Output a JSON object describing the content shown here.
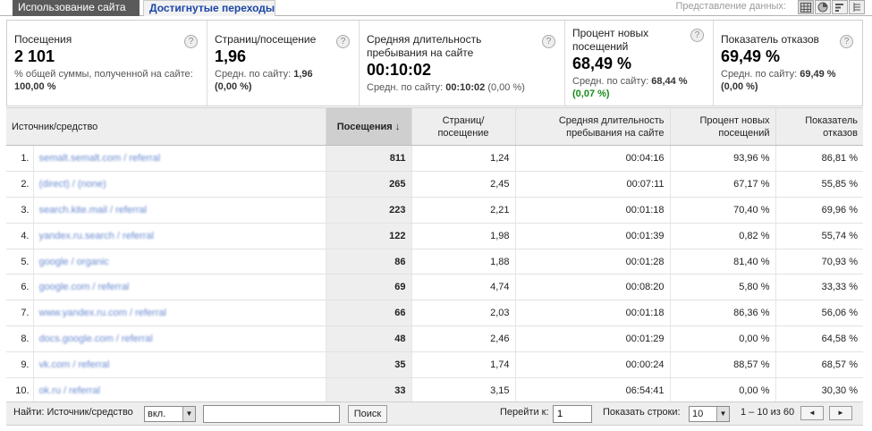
{
  "tabs": [
    {
      "label": "Использование сайта"
    },
    {
      "label": "Достигнутые переходы"
    }
  ],
  "view_label": "Представление данных:",
  "view_buttons": [
    "table-icon",
    "pie-icon",
    "bar-icon",
    "pivot-icon"
  ],
  "summary": [
    {
      "label": "Посещения",
      "value": "2 101",
      "sub": "% общей суммы, полученной на сайте:",
      "sub_value": "100,00 %",
      "sub_extra": ""
    },
    {
      "label": "Страниц/посещение",
      "value": "1,96",
      "sub": "Средн. по сайту:",
      "sub_value": "1,96",
      "sub_extra": "(0,00 %)"
    },
    {
      "label": "Средняя длительность пребывания на сайте",
      "value": "00:10:02",
      "sub": "Средн. по сайту:",
      "sub_value": "00:10:02",
      "sub_extra": "(0,00 %)"
    },
    {
      "label": "Процент новых посещений",
      "value": "68,49 %",
      "sub": "Средн. по сайту:",
      "sub_value": "68,44 %",
      "sub_extra": "(0,07 %)"
    },
    {
      "label": "Показатель отказов",
      "value": "69,49 %",
      "sub": "Средн. по сайту:",
      "sub_value": "69,49 %",
      "sub_extra": "(0,00 %)"
    }
  ],
  "help_glyph": "?",
  "table": {
    "headers": {
      "source": "Источник/средство",
      "visits": "Посещения ↓",
      "pages": "Страниц/посещение",
      "duration": "Средняя длительность пребывания на сайте",
      "new_visits": "Процент новых посещений",
      "bounce": "Показатель отказов"
    },
    "rows": [
      {
        "idx": "1.",
        "source": "semalt.semalt.com / referral",
        "visits": "811",
        "pages": "1,24",
        "duration": "00:04:16",
        "new": "93,96 %",
        "bounce": "86,81 %"
      },
      {
        "idx": "2.",
        "source": "(direct) / (none)",
        "visits": "265",
        "pages": "2,45",
        "duration": "00:07:11",
        "new": "67,17 %",
        "bounce": "55,85 %"
      },
      {
        "idx": "3.",
        "source": "search.kite.mail / referral",
        "visits": "223",
        "pages": "2,21",
        "duration": "00:01:18",
        "new": "70,40 %",
        "bounce": "69,96 %"
      },
      {
        "idx": "4.",
        "source": "yandex.ru.search / referral",
        "visits": "122",
        "pages": "1,98",
        "duration": "00:01:39",
        "new": "0,82 %",
        "bounce": "55,74 %"
      },
      {
        "idx": "5.",
        "source": "google / organic",
        "visits": "86",
        "pages": "1,88",
        "duration": "00:01:28",
        "new": "81,40 %",
        "bounce": "70,93 %"
      },
      {
        "idx": "6.",
        "source": "google.com / referral",
        "visits": "69",
        "pages": "4,74",
        "duration": "00:08:20",
        "new": "5,80 %",
        "bounce": "33,33 %"
      },
      {
        "idx": "7.",
        "source": "www.yandex.ru.com / referral",
        "visits": "66",
        "pages": "2,03",
        "duration": "00:01:18",
        "new": "86,36 %",
        "bounce": "56,06 %"
      },
      {
        "idx": "8.",
        "source": "docs.google.com / referral",
        "visits": "48",
        "pages": "2,46",
        "duration": "00:01:29",
        "new": "0,00 %",
        "bounce": "64,58 %"
      },
      {
        "idx": "9.",
        "source": "vk.com / referral",
        "visits": "35",
        "pages": "1,74",
        "duration": "00:00:24",
        "new": "88,57 %",
        "bounce": "68,57 %"
      },
      {
        "idx": "10.",
        "source": "ok.ru / referral",
        "visits": "33",
        "pages": "3,15",
        "duration": "06:54:41",
        "new": "0,00 %",
        "bounce": "30,30 %"
      }
    ]
  },
  "footer": {
    "find_label": "Найти: Источник/средство",
    "filter_select": "вкл.",
    "search_value": "",
    "search_button": "Поиск",
    "goto_label": "Перейти к:",
    "goto_value": "1",
    "rows_label": "Показать строки:",
    "rows_value": "10",
    "range_text": "1 – 10 из 60",
    "prev_glyph": "◄",
    "next_glyph": "►",
    "dropdown_glyph": "▼"
  }
}
